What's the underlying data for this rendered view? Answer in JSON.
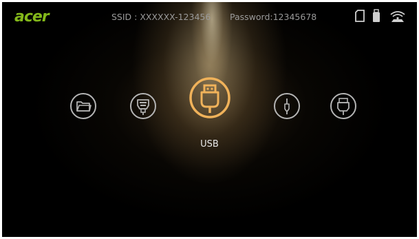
{
  "brand": {
    "logo_text": "acer",
    "logo_color": "#83b81a"
  },
  "header": {
    "ssid": "SSID : XXXXXX-123456",
    "password": "Password:12345678"
  },
  "status_icons": [
    {
      "name": "sd-card-icon"
    },
    {
      "name": "usb-drive-icon"
    },
    {
      "name": "wifi-hotspot-icon"
    }
  ],
  "sources": [
    {
      "name": "folder",
      "icon": "folder-icon"
    },
    {
      "name": "vga",
      "icon": "vga-plug-icon"
    },
    {
      "name": "usb",
      "icon": "usb-plug-icon",
      "selected": true
    },
    {
      "name": "audio",
      "icon": "audio-jack-icon"
    },
    {
      "name": "hdmi",
      "icon": "hdmi-plug-icon"
    }
  ],
  "selected_source_label": "USB",
  "colors": {
    "accent": "#f0b25a",
    "icon_gray": "#b4b4b4",
    "text_gray": "#9a9a9a"
  }
}
